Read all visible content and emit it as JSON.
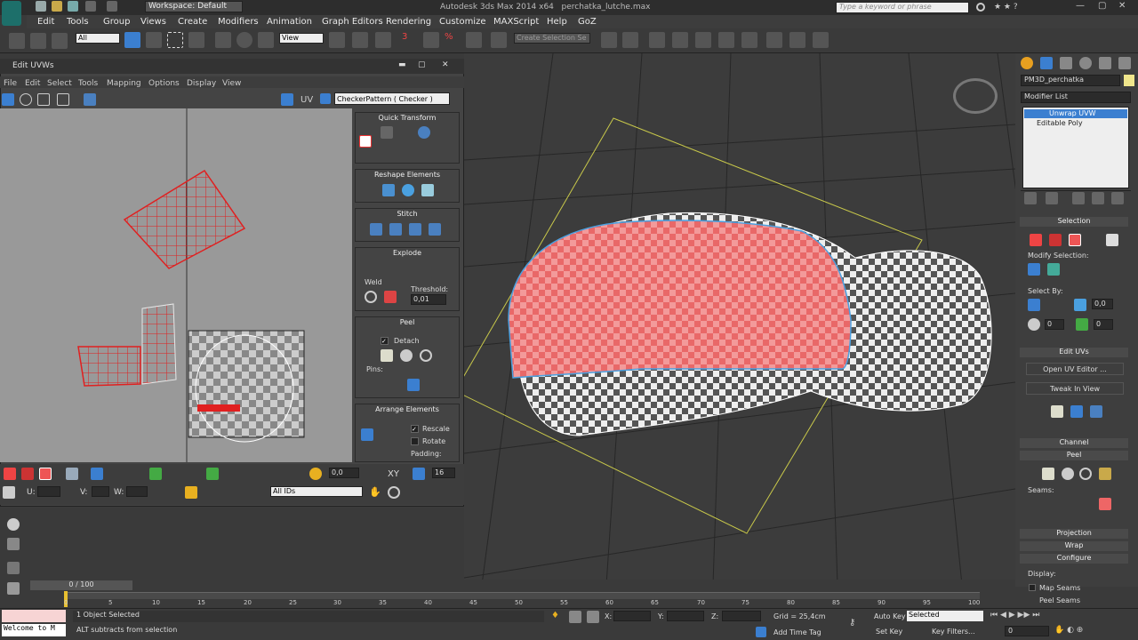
{
  "app": {
    "title": "Autodesk 3ds Max 2014 x64",
    "file": "perchatka_lutche.max",
    "workspace": "Workspace: Default",
    "search_placeholder": "Type a keyword or phrase"
  },
  "menu": [
    "Edit",
    "Tools",
    "Group",
    "Views",
    "Create",
    "Modifiers",
    "Animation",
    "Graph Editors",
    "Rendering",
    "Customize",
    "MAXScript",
    "Help",
    "GoZ"
  ],
  "toolbar": {
    "filter": "All",
    "refcoord": "View",
    "selset": "Create Selection Se"
  },
  "uvw": {
    "title": "Edit UVWs",
    "menu": [
      "File",
      "Edit",
      "Select",
      "Tools",
      "Mapping",
      "Options",
      "Display",
      "View"
    ],
    "uv_label": "UV",
    "checker": "CheckerPattern  ( Checker )",
    "panels": {
      "quick": "Quick Transform",
      "reshape": "Reshape Elements",
      "stitch": "Stitch",
      "explode": "Explode",
      "weld": "Weld",
      "threshold": "Threshold:",
      "threshold_val": "0,01",
      "peel": "Peel",
      "detach": "Detach",
      "pins": "Pins:",
      "arrange": "Arrange Elements",
      "rescale": "Rescale",
      "rotate": "Rotate",
      "padding": "Padding:"
    },
    "bottom": {
      "val1": "0,0",
      "xy": "XY",
      "val2": "16",
      "u": "U:",
      "v": "V:",
      "w": "W:",
      "ids": "All IDs"
    }
  },
  "cmd": {
    "object": "PM3D_perchatka",
    "modlist": "Modifier List",
    "stack": [
      "Unwrap UVW",
      "Editable Poly"
    ],
    "selection": "Selection",
    "modify_sel": "Modify Selection:",
    "select_by": "Select By:",
    "val": "0,0",
    "zero1": "0",
    "zero2": "0",
    "edit_uvs": "Edit UVs",
    "open_editor": "Open UV Editor ...",
    "tweak": "Tweak In View",
    "channel": "Channel",
    "peel": "Peel",
    "seams": "Seams:",
    "projection": "Projection",
    "wrap": "Wrap",
    "configure": "Configure",
    "display": "Display:",
    "map_seams": "Map Seams",
    "peel_seams": "Peel Seams"
  },
  "timeline": {
    "frame": "0 / 100",
    "ticks": [
      "0",
      "5",
      "10",
      "15",
      "20",
      "25",
      "30",
      "35",
      "40",
      "45",
      "50",
      "55",
      "60",
      "65",
      "70",
      "75",
      "80",
      "85",
      "90",
      "95",
      "100"
    ]
  },
  "status": {
    "welcome": "Welcome to M",
    "selected": "1 Object Selected",
    "hint": "ALT subtracts from selection",
    "x": "X:",
    "y": "Y:",
    "z": "Z:",
    "grid": "Grid = 25,4cm",
    "add_tag": "Add Time Tag",
    "autokey": "Auto Key",
    "setkey": "Set Key",
    "sel": "Selected",
    "keyfilters": "Key Filters...",
    "frame": "0"
  }
}
